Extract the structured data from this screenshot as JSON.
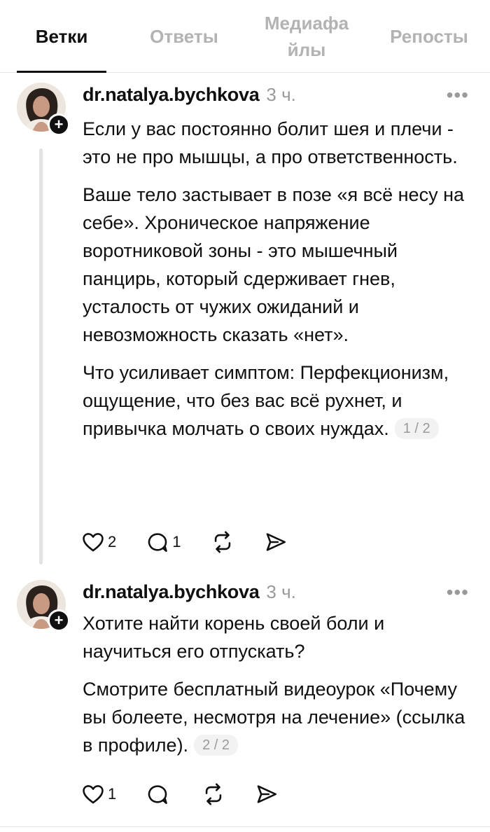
{
  "tabs": [
    {
      "label": "Ветки",
      "active": true
    },
    {
      "label": "Ответы",
      "active": false
    },
    {
      "label": "Медиафа йлы",
      "active": false
    },
    {
      "label": "Репосты",
      "active": false
    }
  ],
  "posts": [
    {
      "author": "dr.natalya.bychkova",
      "time": "3 ч.",
      "paragraphs": [
        "Если у вас постоянно болит шея и плечи - это не про мышцы, а про ответственность.",
        "Ваше тело застывает в позе «я всё несу на себе». Хроническое напряжение воротниковой зоны - это мышечный панцирь, который сдерживает гнев, усталость от чужих ожиданий и невозможность сказать «нет».",
        "Что усиливает симптом: Перфекционизм, ощущение, что без вас всё рухнет, и привычка молчать о своих нуждах."
      ],
      "counter": "1 / 2",
      "likes": "2",
      "replies": "1"
    },
    {
      "author": "dr.natalya.bychkova",
      "time": "3 ч.",
      "paragraphs": [
        "Хотите найти корень своей боли и научиться его отпускать?",
        "Смотрите бесплатный видеоурок «Почему вы болеете, несмотря на лечение» (ссылка в профиле)."
      ],
      "counter": "2 / 2",
      "likes": "1",
      "replies": ""
    }
  ],
  "icons": {
    "like": "heart-icon",
    "reply": "comment-icon",
    "repost": "repost-icon",
    "share": "send-icon",
    "more": "more-icon",
    "follow": "plus-icon"
  },
  "colors": {
    "text": "#101010",
    "muted": "#9a9a9a",
    "tab_inactive": "#b3b3b3",
    "thread_line": "#e3e3e3"
  }
}
